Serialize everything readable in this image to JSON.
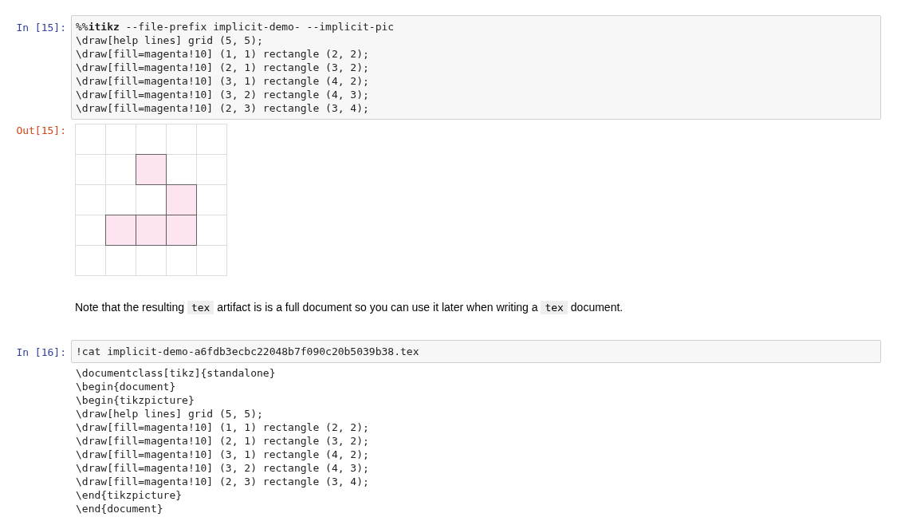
{
  "cells": [
    {
      "kind": "code",
      "prompt": "In [15]:",
      "lines": [
        "%%**itikz** --file-prefix implicit-demo- --implicit-pic",
        "\\draw[help lines] grid (5, 5);",
        "\\draw[fill=magenta!10] (1, 1) rectangle (2, 2);",
        "\\draw[fill=magenta!10] (2, 1) rectangle (3, 2);",
        "\\draw[fill=magenta!10] (3, 1) rectangle (4, 2);",
        "\\draw[fill=magenta!10] (3, 2) rectangle (4, 3);",
        "\\draw[fill=magenta!10] (2, 3) rectangle (3, 4);"
      ]
    },
    {
      "kind": "image",
      "prompt": "Out[15]:"
    },
    {
      "kind": "markdown",
      "parts": [
        {
          "kind": "text",
          "text": "Note that the resulting "
        },
        {
          "kind": "code",
          "text": "tex"
        },
        {
          "kind": "text",
          "text": " artifact is is a full document so you can use it later when writing a "
        },
        {
          "kind": "code",
          "text": "tex"
        },
        {
          "kind": "text",
          "text": " document."
        }
      ]
    },
    {
      "kind": "code",
      "prompt": "In [16]:",
      "lines": [
        "!cat implicit-demo-a6fdb3ecbc22048b7f090c20b5039b38.tex"
      ]
    },
    {
      "kind": "stream",
      "lines": [
        "\\documentclass[tikz]{standalone}",
        "\\begin{document}",
        "\\begin{tikzpicture}",
        "\\draw[help lines] grid (5, 5);",
        "\\draw[fill=magenta!10] (1, 1) rectangle (2, 2);",
        "\\draw[fill=magenta!10] (2, 1) rectangle (3, 2);",
        "\\draw[fill=magenta!10] (3, 1) rectangle (4, 2);",
        "\\draw[fill=magenta!10] (3, 2) rectangle (4, 3);",
        "\\draw[fill=magenta!10] (2, 3) rectangle (3, 4);",
        "\\end{tikzpicture}",
        "\\end{document}"
      ]
    }
  ]
}
